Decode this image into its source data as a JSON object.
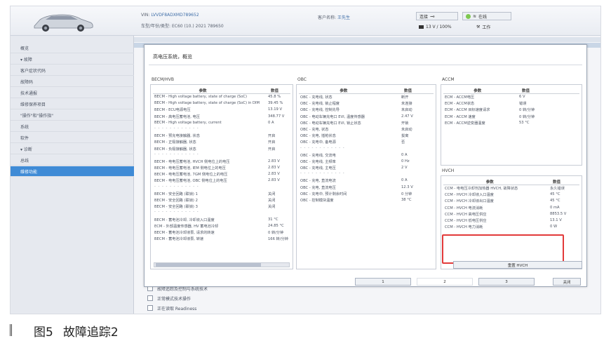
{
  "header": {
    "vin_label": "VIN:",
    "vin_value": "LVVDF8ADXMD789652",
    "model_text": "车型/年份/类型: EC60 (10.) 2021 789650",
    "customer_label": "客户名称:",
    "customer_value": "王先生",
    "connection_label": "连接",
    "network_label": "在线",
    "battery_text": "13 V / 100%",
    "work_label": "工作"
  },
  "sidebar": {
    "items": [
      {
        "label": "概览"
      },
      {
        "label": "▾ 故障"
      },
      {
        "label": "客户症状代码"
      },
      {
        "label": "故障码"
      },
      {
        "label": "技术通报"
      },
      {
        "label": "维修保养项目"
      },
      {
        "label": "\"操作\"和\"操作指\""
      },
      {
        "label": "系统"
      },
      {
        "label": "软件"
      },
      {
        "label": "▾ 诊断"
      },
      {
        "label": "总线"
      },
      {
        "label": "维修功能"
      }
    ],
    "active_index": 11
  },
  "background": {
    "row1": "故障追踪及控制与系统技术",
    "row2": "正常模式技术操作",
    "row3": "正在读取 Readiness"
  },
  "dialog": {
    "title": "高电压系统，概览",
    "becm": {
      "title": "BECM/HVB",
      "headers": [
        "参数",
        "数值"
      ],
      "rows": [
        [
          "BECM - High voltage battery, state of charge (SoC)",
          "45.8 %"
        ],
        [
          "BECM - High voltage battery, state of charge (SoC) in DIM",
          "39.45 %"
        ],
        [
          "BECM - ECU电源电压",
          "13.19 V"
        ],
        [
          "BECM - 高电压蓄电池, 电压",
          "348.77 V"
        ],
        [
          "BECM - High voltage battery, current",
          "0 A"
        ],
        [
          "- - - - - - - - - - - -",
          ""
        ],
        [
          "BECM - 预充电接触器, 状态",
          "开启"
        ],
        [
          "BECM - 正极接触器, 状态",
          "开启"
        ],
        [
          "BECM - 负极接触器, 状态",
          "开启"
        ],
        [
          "- - - - - - - - - - - -",
          ""
        ],
        [
          "BECM - 电电压蓄电池, HVCH 侧电位上的电压",
          "2.83 V"
        ],
        [
          "BECM - 电电压蓄电池, IEM 侧电位上的电压",
          "2.83 V"
        ],
        [
          "BECM - 电电压蓄电池, 7GM 侧电位上的电压",
          "2.83 V"
        ],
        [
          "BECM - 电电压蓄电池, OBC 侧电位上的电压",
          "2.83 V"
        ],
        [
          "- - - - - - - - - - - -",
          ""
        ],
        [
          "BECM - 安全回路 (联锁) 1",
          "关闭"
        ],
        [
          "BECM - 安全回路 (联锁) 2",
          "关闭"
        ],
        [
          "BECM - 安全回路 (联锁) 3",
          "关闭"
        ],
        [
          "- - - - - - - - - - - -",
          ""
        ],
        [
          "BECM - 蓄电池冷却, 冷却液入口温度",
          "31 °C"
        ],
        [
          "ECM - 外部温度传感器, HV 蓄电池冷却",
          "24.85 °C"
        ],
        [
          "BECM - 蓄电池冷却液泵, 请求的转速",
          "0 转/分钟"
        ],
        [
          "BECM - 蓄电池冷却液泵, 转速",
          "166 转/分钟"
        ]
      ]
    },
    "obc": {
      "title": "OBC",
      "headers": [
        "参数",
        "数值"
      ],
      "rows": [
        [
          "OBC - 充电线, 状态",
          "断开"
        ],
        [
          "OBC - 充电线, 锁止程度",
          "未连接"
        ],
        [
          "OBC - 充电线, 控制先导",
          "未启动"
        ],
        [
          "OBC - 电动车辆充电口 EVI, 温度传感器",
          "2.47 V"
        ],
        [
          "OBC - 电动车辆充电口 EVI, 锁止状态",
          "开锁"
        ],
        [
          "OBC - 充电, 状态",
          "未启动"
        ],
        [
          "OBC - 充电, 插枪状态",
          "拔离"
        ],
        [
          "OBC - 充电中, 备电源",
          "否"
        ],
        [
          "- - - - - - - - - - - -",
          ""
        ],
        [
          "OBC - 充电线, 交流电",
          "0 A"
        ],
        [
          "OBC - 充电线, 主频率",
          "0 Hz"
        ],
        [
          "OBC - 充电线, 主电压",
          "2 V"
        ],
        [
          "- - - - - - - - - - - -",
          ""
        ],
        [
          "OBC - 充电, 直流电流",
          "0 A"
        ],
        [
          "OBC - 充电, 直流电压",
          "12.3 V"
        ],
        [
          "OBC - 充电中, 预计剩余时间",
          "0 分钟"
        ],
        [
          "OBC - 控制模块温度",
          "38 °C"
        ]
      ]
    },
    "accm": {
      "title": "ACCM",
      "headers": [
        "参数",
        "数值"
      ],
      "rows": [
        [
          "ECM - ACCM电压",
          "6 V"
        ],
        [
          "ECM - ACCM状态",
          "错误"
        ],
        [
          "ECM - ACCM 目标速度请求",
          "0 转/分钟"
        ],
        [
          "ECM - ACCM 速度",
          "0 转/分钟"
        ],
        [
          "ECM - ACCM逆变器温度",
          "53 °C"
        ]
      ]
    },
    "hvch": {
      "title": "HVCH",
      "headers": [
        "参数",
        "数值"
      ],
      "rows": [
        [
          "CCM - 电电压冷却剂加热器 HVCH, 故障状态",
          "永久错误"
        ],
        [
          "CCM - HVCH 冷却液入口温度",
          "45 °C"
        ],
        [
          "CCM - HVCH 冷却液出口温度",
          "45 °C"
        ],
        [
          "CCM - HVCH 电流消耗",
          "0 mA"
        ],
        [
          "CCM - HVCH 高电压供应",
          "8853.5 V"
        ],
        [
          "CCM - HVCH 低电压供应",
          "13.1 V"
        ],
        [
          "CCM - HVCH 电力消耗",
          "0 W"
        ]
      ],
      "reset_button": "重置 HVCH"
    },
    "pagination": [
      "1",
      "2",
      "3"
    ],
    "close_button": "关闭"
  },
  "caption": {
    "figure": "图5",
    "title": "故障追踪2"
  },
  "colors": {
    "accent": "#3f8bd6",
    "highlight_box": "#e23a3a"
  }
}
